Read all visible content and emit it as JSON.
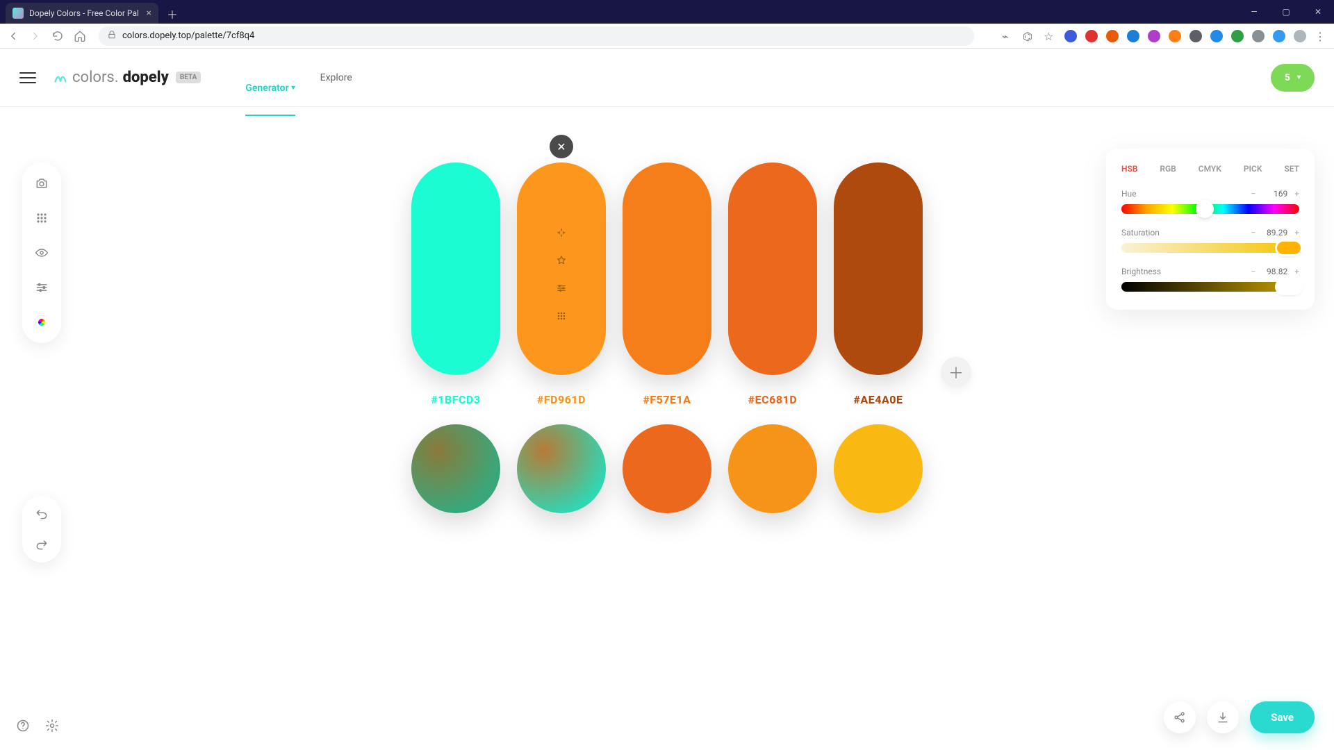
{
  "browser": {
    "tab_title": "Dopely Colors - Free Color Pal",
    "url": "colors.dopely.top/palette/7cf8q4"
  },
  "header": {
    "logo_colors": "colors.",
    "logo_dopely": "dopely",
    "logo_beta": "BETA",
    "nav": {
      "generator": "Generator",
      "explore": "Explore"
    },
    "credits": "5"
  },
  "palette": {
    "swatches": [
      {
        "hex": "#1BFCD3",
        "css": "#1BFCD3"
      },
      {
        "hex": "#FD961D",
        "css": "#FD961D"
      },
      {
        "hex": "#F57E1A",
        "css": "#F57E1A"
      },
      {
        "hex": "#EC681D",
        "css": "#EC681D"
      },
      {
        "hex": "#AE4A0E",
        "css": "#AE4A0E"
      }
    ],
    "blends": [
      {
        "css": "radial-gradient(circle at 30% 30%, #8a7a3a, #3aa77a 70%)"
      },
      {
        "css": "radial-gradient(circle at 30% 30%, #b77a35, #2fd7b3 75%)"
      },
      {
        "css": "#EC681D"
      },
      {
        "css": "#F6941A"
      },
      {
        "css": "#F9B812"
      }
    ]
  },
  "hsb": {
    "tabs": [
      "HSB",
      "RGB",
      "CMYK",
      "PICK",
      "SET"
    ],
    "active_tab": "HSB",
    "hue": {
      "label": "Hue",
      "value": "169",
      "pct": 46.9
    },
    "saturation": {
      "label": "Saturation",
      "value": "89.29",
      "pct": 89.29
    },
    "brightness": {
      "label": "Brightness",
      "value": "98.82",
      "pct": 98.82
    }
  },
  "actions": {
    "save": "Save"
  }
}
